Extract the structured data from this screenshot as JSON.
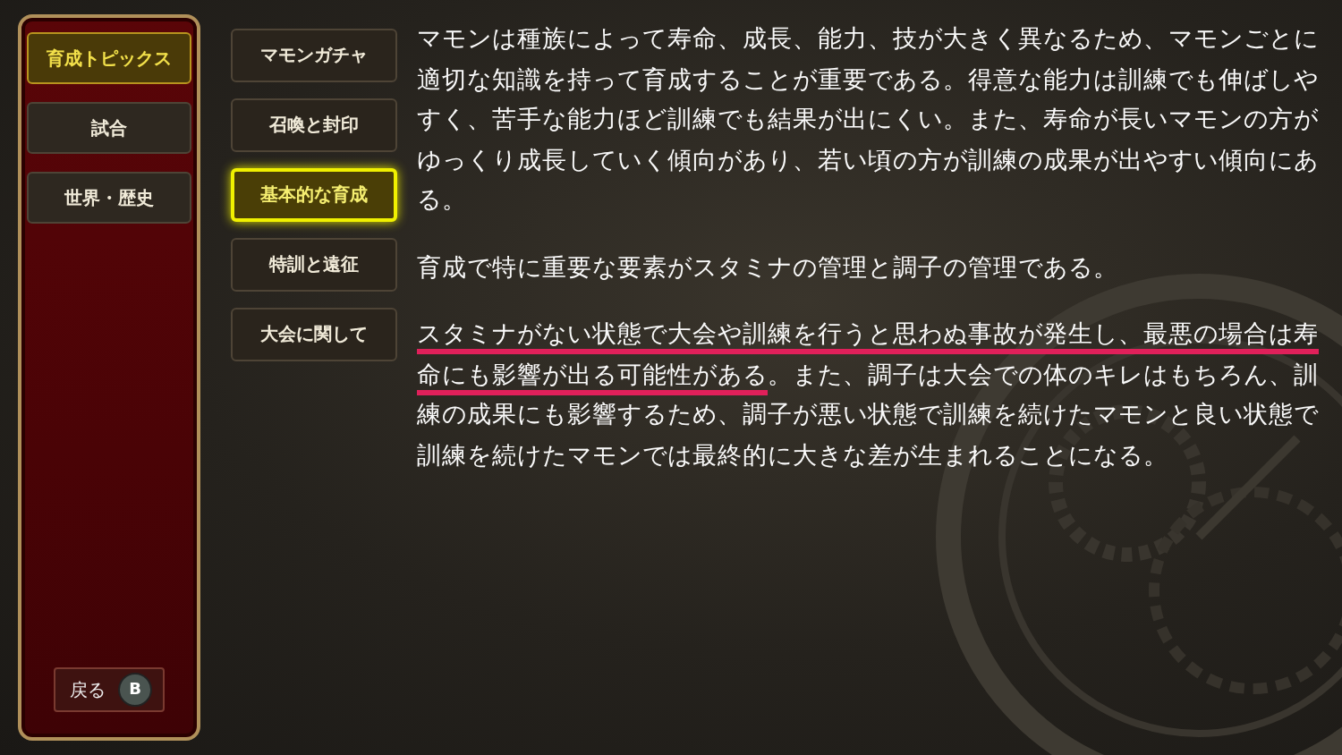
{
  "categories": [
    {
      "label": "育成トピックス",
      "selected": true
    },
    {
      "label": "試合",
      "selected": false
    },
    {
      "label": "世界・歴史",
      "selected": false
    }
  ],
  "back_button": {
    "label": "戻る",
    "key": "B"
  },
  "topics": [
    {
      "label": "マモンガチャ",
      "selected": false
    },
    {
      "label": "召喚と封印",
      "selected": false
    },
    {
      "label": "基本的な育成",
      "selected": true
    },
    {
      "label": "特訓と遠征",
      "selected": false
    },
    {
      "label": "大会に関して",
      "selected": false
    }
  ],
  "paragraphs": [
    [
      {
        "text": "マモンは種族によって寿命、成長、能力、技が大きく異なるため、マモンごとに適切な知識を持って育成することが重要である。得意な能力は訓練でも伸ばしやすく、苦手な能力ほど訓練でも結果が出にくい。また、寿命が長いマモンの方がゆっくり成長していく傾向があり、若い頃の方が訓練の成果が出やすい傾向にある。",
        "underline": false
      }
    ],
    [
      {
        "text": "育成で特に重要な要素がスタミナの管理と調子の管理である。",
        "underline": false
      }
    ],
    [
      {
        "text": "スタミナがない状態で大会や訓練を行うと思わぬ事故が発生し、最悪の場合は寿命にも影響が出る可能性がある",
        "underline": true
      },
      {
        "text": "。また、調子は大会での体のキレはもちろん、訓練の成果にも影響するため、調子が悪い状態で訓練を続けたマモンと良い状態で訓練を続けたマモンでは最終的に大きな差が生まれることになる。",
        "underline": false
      }
    ]
  ]
}
